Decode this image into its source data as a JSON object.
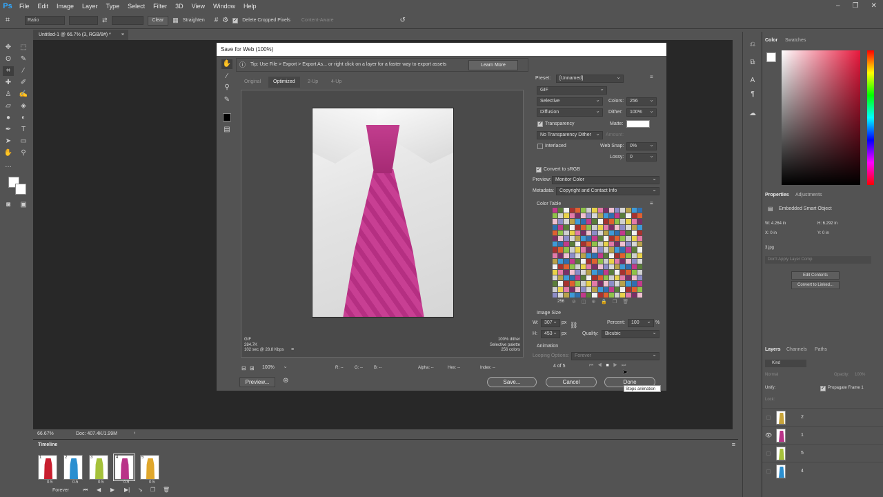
{
  "app": {
    "logo": "Ps"
  },
  "menu": [
    "File",
    "Edit",
    "Image",
    "Layer",
    "Type",
    "Select",
    "Filter",
    "3D",
    "View",
    "Window",
    "Help"
  ],
  "window_controls": [
    "–",
    "❐",
    "✕"
  ],
  "options_bar": {
    "ratio": "Ratio",
    "clear": "Clear",
    "straighten": "Straighten",
    "delete_cropped": "Delete Cropped Pixels",
    "content_aware": "Content-Aware"
  },
  "document_tab": {
    "title": "Untitled-1 @ 66.7% (3, RGB/8#) *",
    "close": "×"
  },
  "status": {
    "zoom": "66.67%",
    "doc": "Doc: 407.4K/1.99M"
  },
  "timeline": {
    "title": "Timeline",
    "frames": [
      {
        "num": "1",
        "delay": "0.5",
        "color": "#c81e2e"
      },
      {
        "num": "2",
        "delay": "0.5",
        "color": "#2b8fd0"
      },
      {
        "num": "3",
        "delay": "0.5",
        "color": "#a5c13a"
      },
      {
        "num": "4",
        "delay": "0.5",
        "color": "#b93388"
      },
      {
        "num": "5",
        "delay": "0.5",
        "color": "#e0a72c"
      }
    ],
    "loop": "Forever"
  },
  "dialog": {
    "title": "Save for Web (100%)",
    "tip": "Tip: Use File > Export > Export As... or right click on a layer for a faster way to export assets",
    "learn_more": "Learn More",
    "view_tabs": [
      "Original",
      "Optimized",
      "2-Up",
      "4-Up"
    ],
    "active_tab": "Optimized",
    "preview_info_left": [
      "GIF",
      "284.7K",
      "102 sec @ 28.8 Kbps"
    ],
    "preview_info_right": [
      "100% dither",
      "Selective palette",
      "256 colors"
    ],
    "zoom": "100%",
    "readouts": {
      "r": "R: --",
      "g": "G: --",
      "b": "B: --",
      "alpha": "Alpha: --",
      "hex": "Hex: --",
      "index": "Index: --"
    },
    "preset_label": "Preset:",
    "preset": "[Unnamed]",
    "format": "GIF",
    "palette": "Selective",
    "dither_algo": "Diffusion",
    "colors_label": "Colors:",
    "colors": "256",
    "dither_label": "Dither:",
    "dither": "100%",
    "transparency": "Transparency",
    "matte_label": "Matte:",
    "transparency_dither": "No Transparency Dither",
    "amount_label": "Amount:",
    "interlaced": "Interlaced",
    "websnap_label": "Web Snap:",
    "websnap": "0%",
    "lossy_label": "Lossy:",
    "lossy": "0",
    "convert_srgb": "Convert to sRGB",
    "preview_label": "Preview:",
    "preview_value": "Monitor Color",
    "metadata_label": "Metadata:",
    "metadata_value": "Copyright and Contact Info",
    "color_table_label": "Color Table",
    "color_count": "256",
    "image_size_label": "Image Size",
    "w_label": "W:",
    "width": "307",
    "h_label": "H:",
    "height": "453",
    "px": "px",
    "percent_label": "Percent:",
    "percent": "100",
    "pct": "%",
    "quality_label": "Quality:",
    "quality": "Bicubic",
    "animation_label": "Animation",
    "looping_label": "Looping Options:",
    "looping": "Forever",
    "frame_counter": "4 of 5",
    "preview_btn": "Preview...",
    "save_btn": "Save...",
    "cancel_btn": "Cancel",
    "done_btn": "Done",
    "tooltip": "Stops animation",
    "palette_colors": [
      "#c23a8c",
      "#e8d24a",
      "#3e9ad8",
      "#8fc24a",
      "#d7d7d7",
      "#a7322f",
      "#f0c0d0",
      "#5a7d3a",
      "#e37aa8",
      "#2f6fb0",
      "#cfcfcf",
      "#b8a24a",
      "#e06030",
      "#8c8cc8",
      "#f2f2f2",
      "#7a2f66"
    ]
  },
  "properties": {
    "tabs": [
      "Properties",
      "Adjustments"
    ],
    "type": "Embedded Smart Object",
    "w": "W: 4.264 in",
    "h": "H: 6.292 in",
    "x": "X: 0 in",
    "y": "Y: 0 in",
    "file": "3.jpg",
    "dont_apply": "Don't Apply Layer Comp",
    "edit_contents": "Edit Contents",
    "convert_linked": "Convert to Linked..."
  },
  "color_panel": {
    "tabs": [
      "Color",
      "Swatches"
    ]
  },
  "layers": {
    "tabs": [
      "Layers",
      "Channels",
      "Paths"
    ],
    "kind": "Kind",
    "blend": "Normal",
    "opacity": "Opacity:",
    "opacity_value": "100%",
    "unify": "Unify:",
    "propagate": "Propagate Frame 1",
    "lock": "Lock:",
    "items": [
      {
        "name": "2",
        "color": "#c8a43a"
      },
      {
        "name": "1",
        "color": "#b93388"
      },
      {
        "name": "5",
        "color": "#a5c13a"
      },
      {
        "name": "4",
        "color": "#2b8fd0"
      }
    ]
  }
}
